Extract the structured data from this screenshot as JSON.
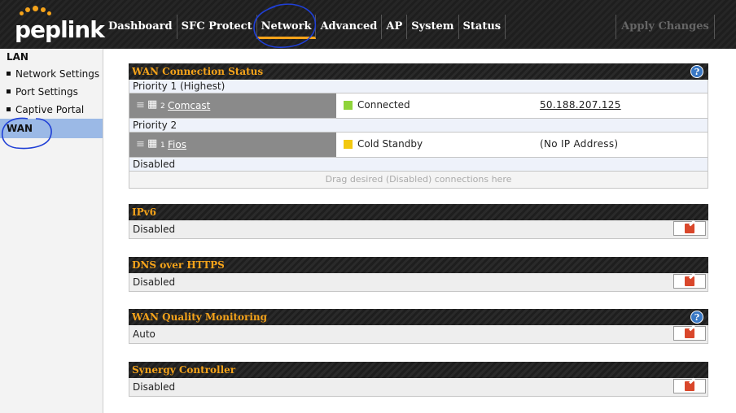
{
  "brand": {
    "logo_text": "peplink"
  },
  "nav": {
    "items": [
      {
        "label": "Dashboard"
      },
      {
        "label": "SFC Protect"
      },
      {
        "label": "Network",
        "active": true
      },
      {
        "label": "Advanced"
      },
      {
        "label": "AP"
      },
      {
        "label": "System"
      },
      {
        "label": "Status"
      }
    ],
    "apply_label": "Apply Changes"
  },
  "sidebar": {
    "lan_heading": "LAN",
    "items": [
      {
        "label": "Network Settings"
      },
      {
        "label": "Port Settings"
      },
      {
        "label": "Captive Portal"
      }
    ],
    "active_item": "WAN"
  },
  "wan_status": {
    "title": "WAN Connection Status",
    "priority1_label": "Priority 1 (Highest)",
    "priority2_label": "Priority 2",
    "disabled_label": "Disabled",
    "dropzone_text": "Drag desired (Disabled) connections here",
    "connections": [
      {
        "port_number": "2",
        "name": "Comcast",
        "status": "Connected",
        "status_color": "#8fd43a",
        "ip": "50.188.207.125"
      },
      {
        "port_number": "1",
        "name": "Fios",
        "status": "Cold Standby",
        "status_color": "#f2c80f",
        "ip": "(No IP Address)"
      }
    ]
  },
  "sections": {
    "ipv6": {
      "title": "IPv6",
      "value": "Disabled"
    },
    "doh": {
      "title": "DNS over HTTPS",
      "value": "Disabled"
    },
    "wqm": {
      "title": "WAN Quality Monitoring",
      "value": "Auto"
    },
    "synergy": {
      "title": "Synergy Controller",
      "value": "Disabled"
    }
  },
  "icons": {
    "help": "help-icon",
    "edit": "edit-icon",
    "grip": "drag-handle-icon",
    "network": "network-port-icon"
  },
  "colors": {
    "accent": "#f5a31a",
    "sidebar_active": "#9bb9e6",
    "annotation": "#1f3fd6"
  }
}
